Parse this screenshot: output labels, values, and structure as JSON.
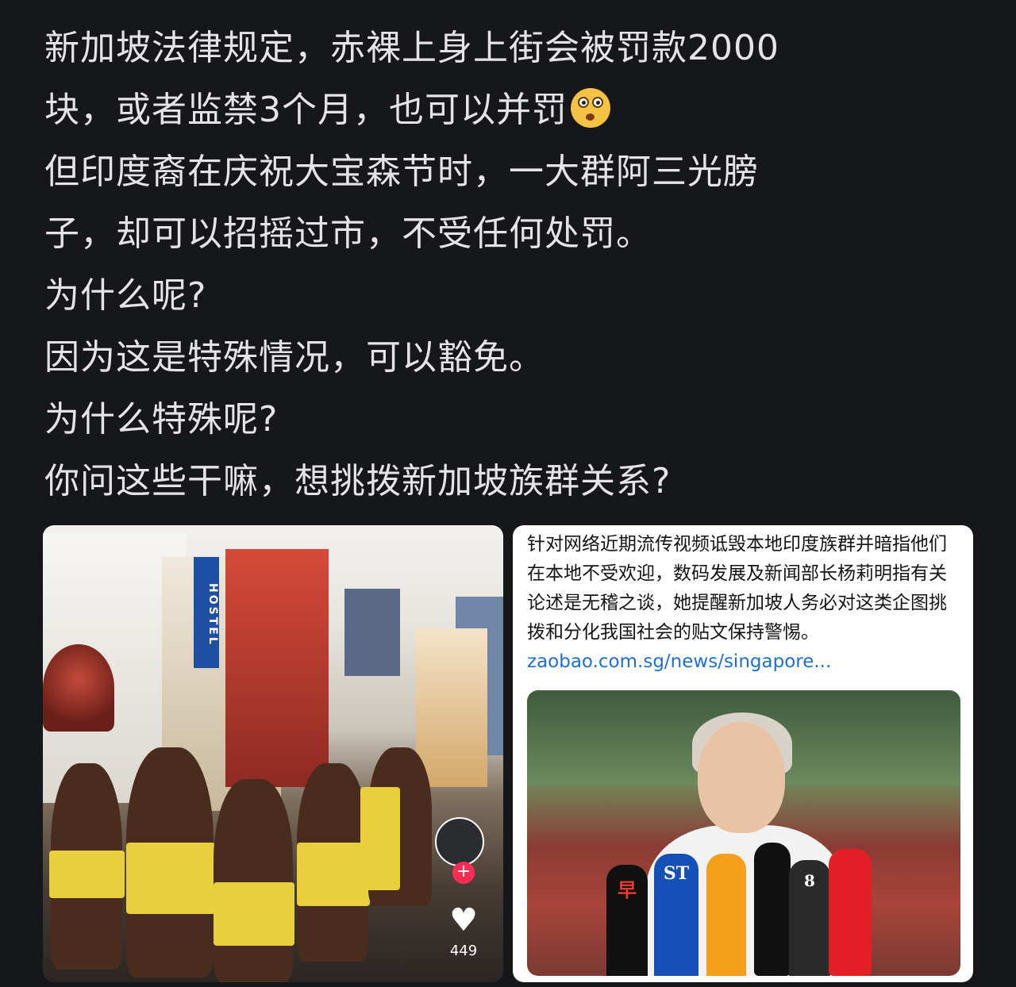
{
  "post": {
    "lines": [
      "新加坡法律规定，赤裸上身上街会被罚款2000",
      "块，或者监禁3个月，也可以并罚",
      "但印度裔在庆祝大宝森节时，一大群阿三光膀",
      "子，却可以招摇过市，不受任何处罚。",
      "为什么呢?",
      "因为这是特殊情况，可以豁免。",
      "为什么特殊呢?",
      "你问这些干嘛，想挑拨新加坡族群关系?"
    ],
    "emoji_icon": "flushed-face-hand-over-mouth-emoji"
  },
  "left_image": {
    "hostel_sign": "HOSTEL",
    "like_count": "449",
    "icons": [
      "plus-icon",
      "heart-icon",
      "avatar"
    ]
  },
  "news_card": {
    "text": "针对网络近期流传视频诋毁本地印度族群并暗指他们在本地不受欢迎，数码发展及新闻部长杨莉明指有关论述是无稽之谈，她提醒新加坡人务必对这类企图挑拨和分化我国社会的贴文保持警惕。",
    "link": "zaobao.com.sg/news/singapore...",
    "mic_labels": [
      "ST",
      "早",
      "8"
    ]
  },
  "colors": {
    "background": "#16171b",
    "text": "#e4e4e6",
    "link": "#1d6fd6",
    "tiktok_red": "#fe2c55"
  }
}
